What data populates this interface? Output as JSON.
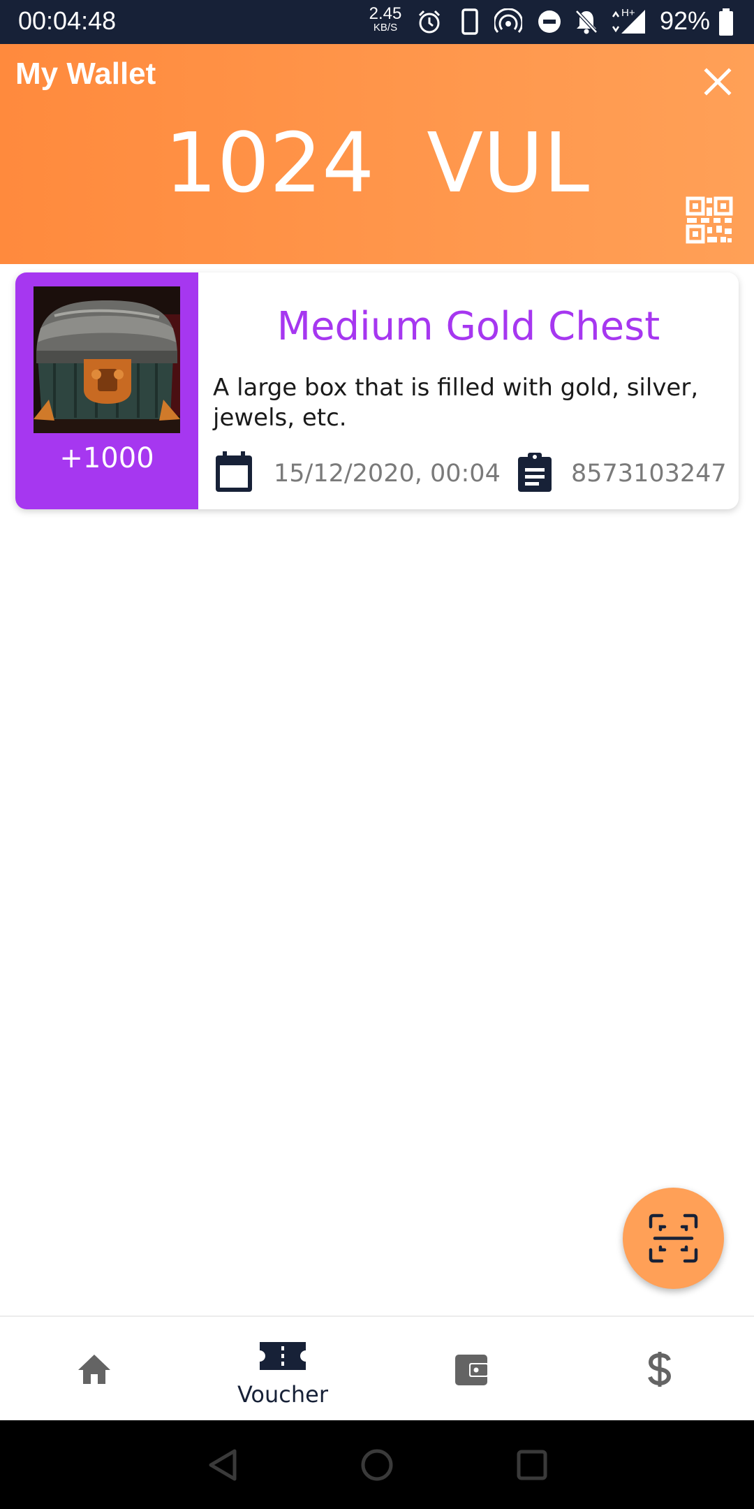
{
  "status_bar": {
    "time": "00:04:48",
    "net_speed_value": "2.45",
    "net_speed_unit": "KB/S",
    "network_type": "H+",
    "battery_percent": "92%",
    "icons": [
      "alarm-icon",
      "phone-icon",
      "hotspot-icon",
      "do-not-disturb-icon",
      "bell-off-icon",
      "signal-icon",
      "battery-icon"
    ]
  },
  "header": {
    "title": "My Wallet",
    "balance": "1024  VUL",
    "close_icon": "close-icon",
    "qr_icon": "qr-code-icon",
    "gradient": [
      "#ff8a3d",
      "#ffa057"
    ]
  },
  "vouchers": [
    {
      "title": "Medium Gold Chest",
      "description": "A large box that is filled with gold, silver, jewels, etc.",
      "points": "+1000",
      "date": "15/12/2020, 00:04",
      "code": "8573103247",
      "accent": "#a637f0"
    }
  ],
  "fab": {
    "icon": "scan-icon",
    "color": "#ffa057"
  },
  "bottom_nav": {
    "items": [
      {
        "icon": "home-icon",
        "label": ""
      },
      {
        "icon": "voucher-icon",
        "label": "Voucher",
        "active": true
      },
      {
        "icon": "wallet-icon",
        "label": ""
      },
      {
        "icon": "dollar-icon",
        "label": ""
      }
    ]
  },
  "system_nav": {
    "icons": [
      "back-icon",
      "home-circle-icon",
      "recents-icon"
    ]
  }
}
